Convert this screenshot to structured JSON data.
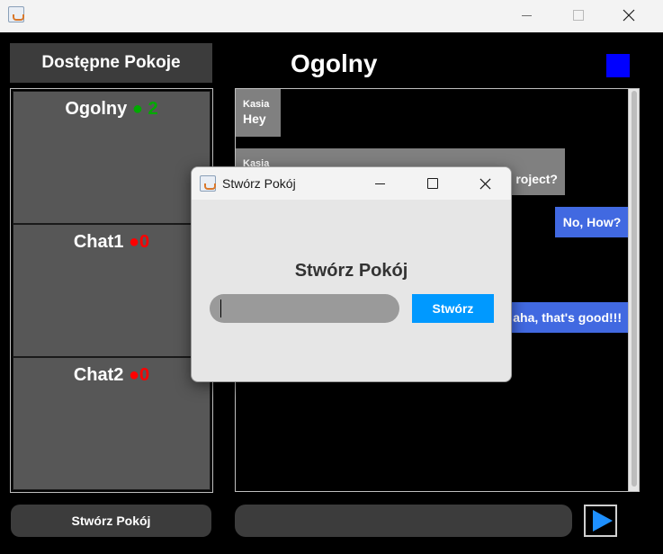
{
  "window": {
    "title": ""
  },
  "sidebar": {
    "header": "Dostępne Pokoje",
    "rooms": [
      {
        "name": "Ogolny",
        "dot": "●",
        "count": "2",
        "status_color": "#00aa00"
      },
      {
        "name": "Chat1",
        "dot": "●",
        "count": "0",
        "status_color": "#ff0000"
      },
      {
        "name": "Chat2",
        "dot": "●",
        "count": "0",
        "status_color": "#ff0000"
      }
    ],
    "create_button": "Stwórz Pokój"
  },
  "chat": {
    "title": "Ogolny",
    "status_color": "#0000ff",
    "messages": [
      {
        "sender": "Kasia",
        "text": "Hey",
        "mine": false
      },
      {
        "sender": "Kasia",
        "text": "roject?",
        "mine": false
      },
      {
        "sender": "",
        "text": "No, How?",
        "mine": true
      },
      {
        "sender": "",
        "text": "aha, that's good!!!",
        "mine": true
      }
    ],
    "input": {
      "value": "",
      "placeholder": ""
    },
    "send_icon": "play-arrow-icon"
  },
  "dialog": {
    "title": "Stwórz Pokój",
    "heading": "Stwórz Pokój",
    "input": {
      "value": "",
      "placeholder": ""
    },
    "create_button": "Stwórz"
  }
}
